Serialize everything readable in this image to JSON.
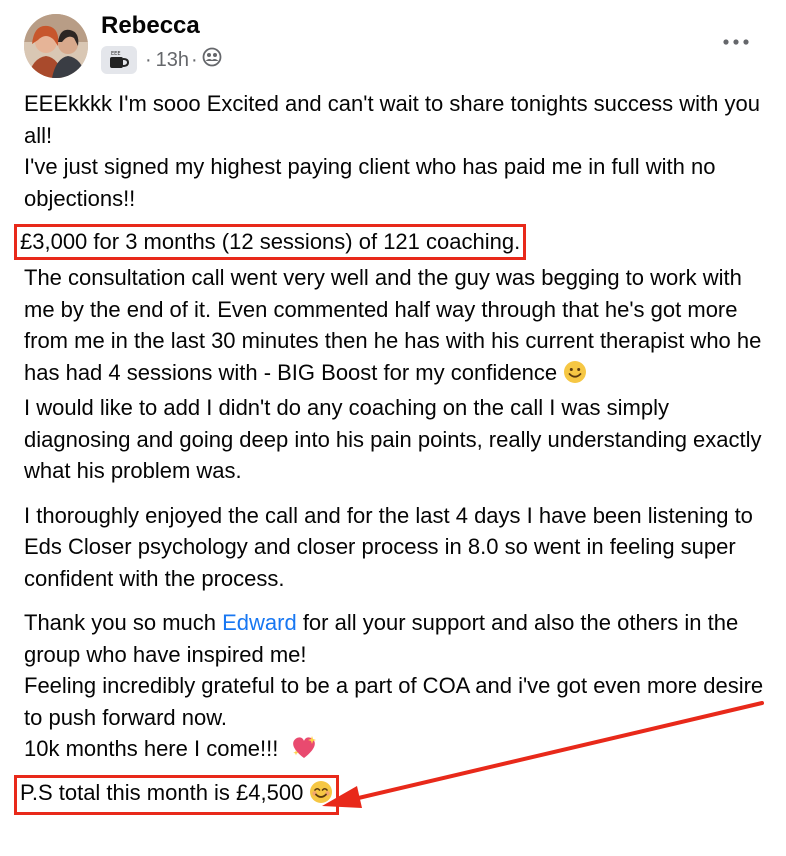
{
  "post": {
    "author": "Rebecca",
    "timestamp": "13h",
    "separator": "·",
    "audience_icon": "group-members-icon",
    "badge_icon": "coffee-mug-badge-icon",
    "more_icon": "more-options-icon"
  },
  "body": {
    "p1_line1": "EEEkkkk I'm sooo Excited and can't wait to share tonights success with you all!",
    "p1_line2": "I've just signed my highest paying client who has paid me in full with no objections!!",
    "highlight1": "£3,000 for 3 months (12 sessions) of 121 coaching.",
    "p2": "The consultation call went very well and the guy was begging to work with me by the end of it. Even commented half way through that he's got more from me in the last 30 minutes then he has with his current therapist who he has had 4 sessions with - BIG Boost for my confidence",
    "p2b": "I would like to add I didn't do any coaching on the call I was simply diagnosing and going deep into his pain points, really understanding exactly what his problem was.",
    "p3": "I thoroughly enjoyed the call and for the last 4 days I have been listening to Eds Closer psychology and closer process in 8.0 so went in feeling super confident with the process.",
    "p4_before_link": "Thank you so much ",
    "p4_link": "Edward",
    "p4_after_link": " for all your support and also the others in the group who have inspired me!",
    "p4b": "Feeling incredibly grateful to be a part of COA and i've got even more desire to push forward now.",
    "p4c": "10k months here I come!!!",
    "highlight2": "P.S total this month is £4,500"
  },
  "colors": {
    "highlight_border": "#e8291a",
    "link": "#1877f2",
    "meta": "#65676b"
  }
}
